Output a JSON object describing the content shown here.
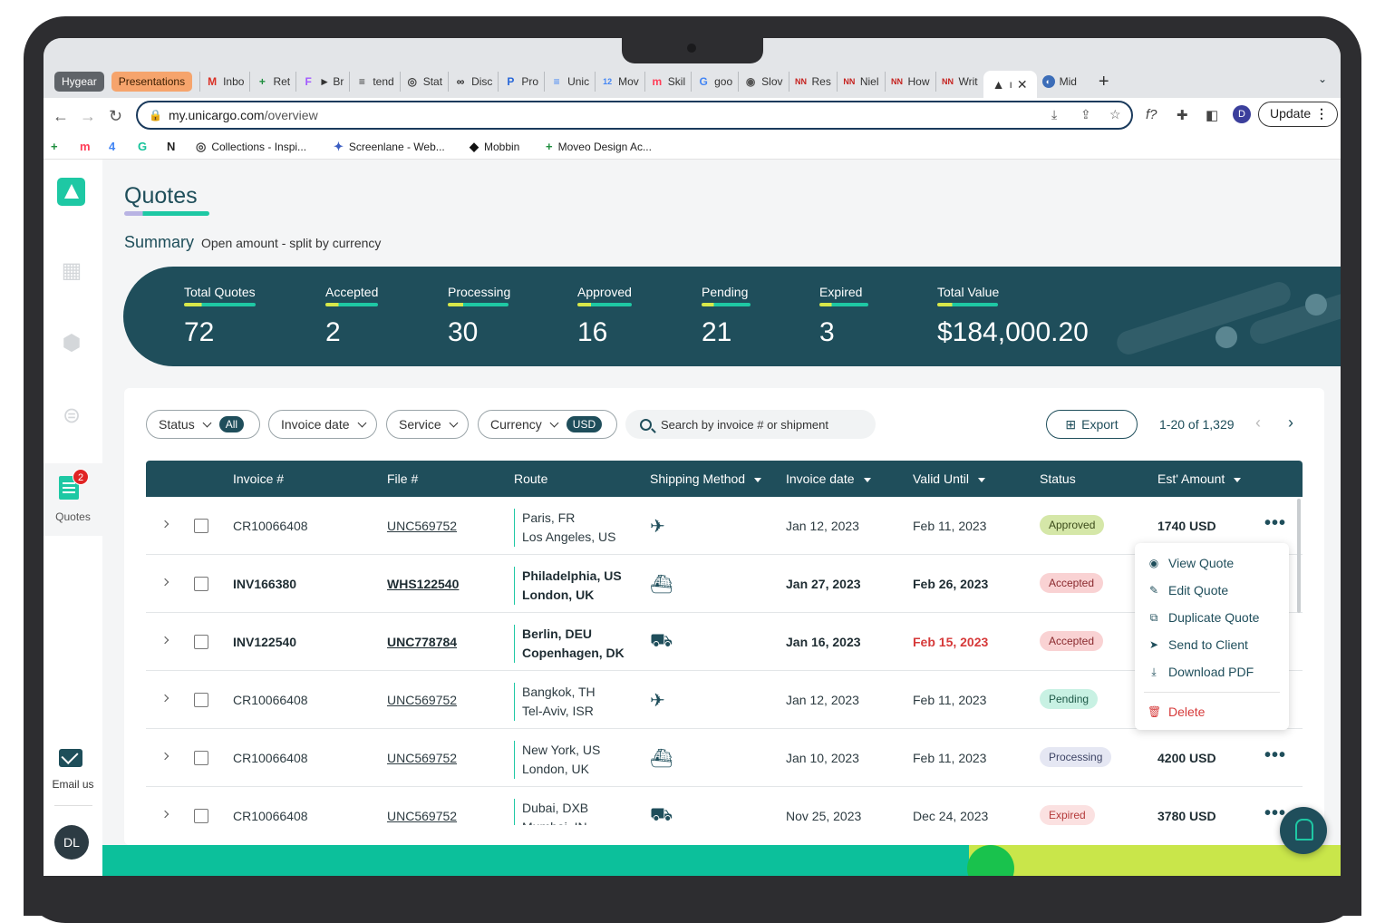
{
  "browser": {
    "profile_tabs": [
      "Hygear",
      "Presentations"
    ],
    "tabs": [
      {
        "label": "Inbo",
        "icon": "gmail-icon",
        "color": "#d93025",
        "glyph": "M"
      },
      {
        "label": "Ret",
        "icon": "sheets-icon",
        "color": "#1e8e3e",
        "glyph": "+"
      },
      {
        "label": "► Br",
        "icon": "figma-icon",
        "color": "#a259ff",
        "glyph": "F"
      },
      {
        "label": "tend",
        "icon": "page-icon",
        "color": "#333333",
        "glyph": "≡"
      },
      {
        "label": "Stat",
        "icon": "globe-icon",
        "color": "#444444",
        "glyph": "◎"
      },
      {
        "label": "Disc",
        "icon": "infinity-icon",
        "color": "#222222",
        "glyph": "∞"
      },
      {
        "label": "Pro",
        "icon": "pen-icon",
        "color": "#2867d8",
        "glyph": "P"
      },
      {
        "label": "Unic",
        "icon": "docs-icon",
        "color": "#4285f4",
        "glyph": "≡"
      },
      {
        "label": "Mov",
        "icon": "calendar-icon",
        "color": "#4285f4",
        "glyph": "12"
      },
      {
        "label": "Skil",
        "icon": "monday-icon",
        "color": "#ff3d57",
        "glyph": "m"
      },
      {
        "label": "goo",
        "icon": "google-icon",
        "color": "#4285f4",
        "glyph": "G"
      },
      {
        "label": "Slov",
        "icon": "openai-icon",
        "color": "#555555",
        "glyph": "◉"
      },
      {
        "label": "Res",
        "icon": "nn-icon",
        "color": "#c5221f",
        "glyph": "NN"
      },
      {
        "label": "Niel",
        "icon": "nn-icon",
        "color": "#c5221f",
        "glyph": "NN"
      },
      {
        "label": "How",
        "icon": "nn-icon",
        "color": "#c5221f",
        "glyph": "NN"
      },
      {
        "label": "Writ",
        "icon": "nn-icon",
        "color": "#c5221f",
        "glyph": "NN"
      }
    ],
    "active_tab": {
      "label": "ı",
      "icon": "unicargo-tab-icon"
    },
    "last_tab": {
      "label": "Mid"
    },
    "url_host": "my.unicargo.com",
    "url_path": "/overview",
    "update_label": "Update",
    "profile_initial": "D",
    "bookmarks": [
      {
        "label": "",
        "icon": "sheets-icon"
      },
      {
        "label": "",
        "icon": "monday-icon"
      },
      {
        "label": "",
        "icon": "calendar-icon"
      },
      {
        "label": "",
        "icon": "grammarly-icon"
      },
      {
        "label": "",
        "icon": "notion-icon"
      },
      {
        "label": "Collections - Inspi...",
        "icon": "globe-icon"
      },
      {
        "label": "Screenlane - Web...",
        "icon": "screenlane-icon"
      },
      {
        "label": "Mobbin",
        "icon": "mobbin-icon"
      },
      {
        "label": "Moveo Design Ac...",
        "icon": "sheets-icon"
      }
    ]
  },
  "sidebar": {
    "quotes_label": "Quotes",
    "quotes_badge": "2",
    "email_label": "Email us",
    "user_initials": "DL"
  },
  "page": {
    "title": "Quotes",
    "summary_title": "Summary",
    "summary_subtitle": "Open amount - split by currency"
  },
  "stats": [
    {
      "label": "Total Quotes",
      "value": "72"
    },
    {
      "label": "Accepted",
      "value": "2"
    },
    {
      "label": "Processing",
      "value": "30"
    },
    {
      "label": "Approved",
      "value": "16"
    },
    {
      "label": "Pending",
      "value": "21"
    },
    {
      "label": "Expired",
      "value": "3"
    },
    {
      "label": "Total Value",
      "value": "$184,000.20"
    }
  ],
  "filters": {
    "status_label": "Status",
    "status_chip": "All",
    "invoice_date_label": "Invoice date",
    "service_label": "Service",
    "currency_label": "Currency",
    "currency_chip": "USD",
    "search_placeholder": "Search by invoice # or shipment",
    "export_label": "Export",
    "pagination": "1-20 of 1,329"
  },
  "table": {
    "columns": [
      "Invoice #",
      "File #",
      "Route",
      "Shipping Method",
      "Invoice date",
      "Valid Until",
      "Status",
      "Est' Amount"
    ],
    "rows": [
      {
        "invoice": "CR10066408",
        "file": "UNC569752",
        "from": "Paris, FR",
        "to": "Los Angeles, US",
        "method": "air",
        "invoice_date": "Jan 12, 2023",
        "valid_until": "Feb 11, 2023",
        "status": "Approved",
        "amount": "1740 USD"
      },
      {
        "invoice": "INV166380",
        "file": "WHS122540",
        "from": "Philadelphia, US",
        "to": "London, UK",
        "method": "sea",
        "invoice_date": "Jan 27, 2023",
        "valid_until": "Feb 26, 2023",
        "status": "Accepted",
        "amount": ""
      },
      {
        "invoice": "INV122540",
        "file": "UNC778784",
        "from": "Berlin, DEU",
        "to": "Copenhagen, DK",
        "method": "truck",
        "invoice_date": "Jan 16, 2023",
        "valid_until": "Feb 15, 2023",
        "status": "Accepted",
        "amount": ""
      },
      {
        "invoice": "CR10066408",
        "file": "UNC569752",
        "from": "Bangkok, TH",
        "to": "Tel-Aviv, ISR",
        "method": "air",
        "invoice_date": "Jan 12, 2023",
        "valid_until": "Feb 11, 2023",
        "status": "Pending",
        "amount": ""
      },
      {
        "invoice": "CR10066408",
        "file": "UNC569752",
        "from": "New York, US",
        "to": "London, UK",
        "method": "sea",
        "invoice_date": "Jan 10, 2023",
        "valid_until": "Feb 11, 2023",
        "status": "Processing",
        "amount": "4200 USD"
      },
      {
        "invoice": "CR10066408",
        "file": "UNC569752",
        "from": "Dubai, DXB",
        "to": "Mumbai, IN",
        "method": "truck",
        "invoice_date": "Nov 25, 2023",
        "valid_until": "Dec 24, 2023",
        "status": "Expired",
        "amount": "3780 USD"
      }
    ]
  },
  "context_menu": {
    "items": [
      "View Quote",
      "Edit Quote",
      "Duplicate Quote",
      "Send to Client",
      "Download PDF"
    ],
    "delete_label": "Delete"
  },
  "colors": {
    "brand_dark": "#1f4e5b",
    "brand_teal": "#1ec8a4",
    "danger": "#d63a3a",
    "accent_lime": "#d7e84a"
  }
}
